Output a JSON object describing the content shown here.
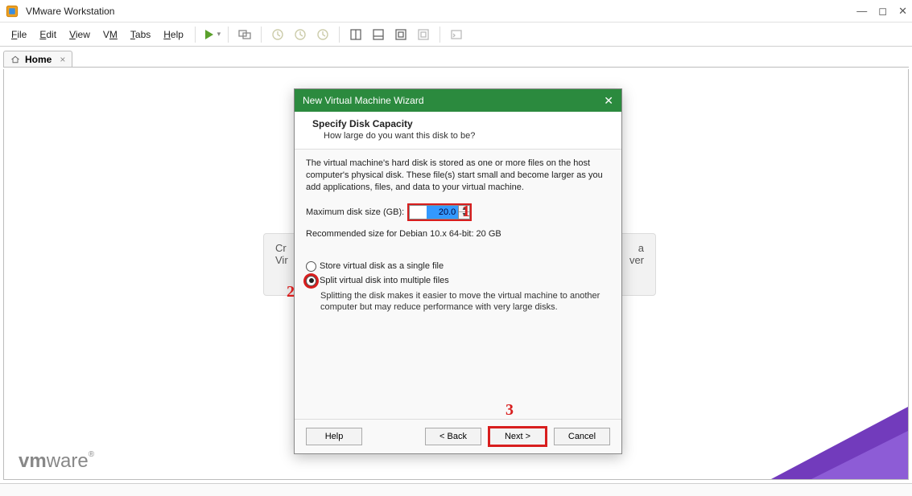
{
  "titlebar": {
    "app_title": "VMware Workstation"
  },
  "menu": {
    "file": "File",
    "edit": "Edit",
    "view": "View",
    "vm": "VM",
    "tabs": "Tabs",
    "help": "Help"
  },
  "tab": {
    "label": "Home"
  },
  "bgcard": {
    "left1": "Cr",
    "right1": "a",
    "left2": "Vir",
    "right2": "ver"
  },
  "logo": {
    "bold": "vm",
    "rest": "ware",
    "reg": "®"
  },
  "dialog": {
    "title": "New Virtual Machine Wizard",
    "h1": "Specify Disk Capacity",
    "h2": "How large do you want this disk to be?",
    "intro": "The virtual machine's hard disk is stored as one or more files on the host computer's physical disk. These file(s) start small and become larger as you add applications, files, and data to your virtual machine.",
    "disk_label": "Maximum disk size (GB):",
    "disk_value": "20.0",
    "reco": "Recommended size for Debian 10.x 64-bit: 20 GB",
    "opt1": "Store virtual disk as a single file",
    "opt2": "Split virtual disk into multiple files",
    "opt2_help": "Splitting the disk makes it easier to move the virtual machine to another computer but may reduce performance with very large disks.",
    "help_btn": "Help",
    "back_btn": "< Back",
    "next_btn": "Next >",
    "cancel_btn": "Cancel"
  },
  "annotations": {
    "a1": "1",
    "a2": "2",
    "a3": "3"
  }
}
